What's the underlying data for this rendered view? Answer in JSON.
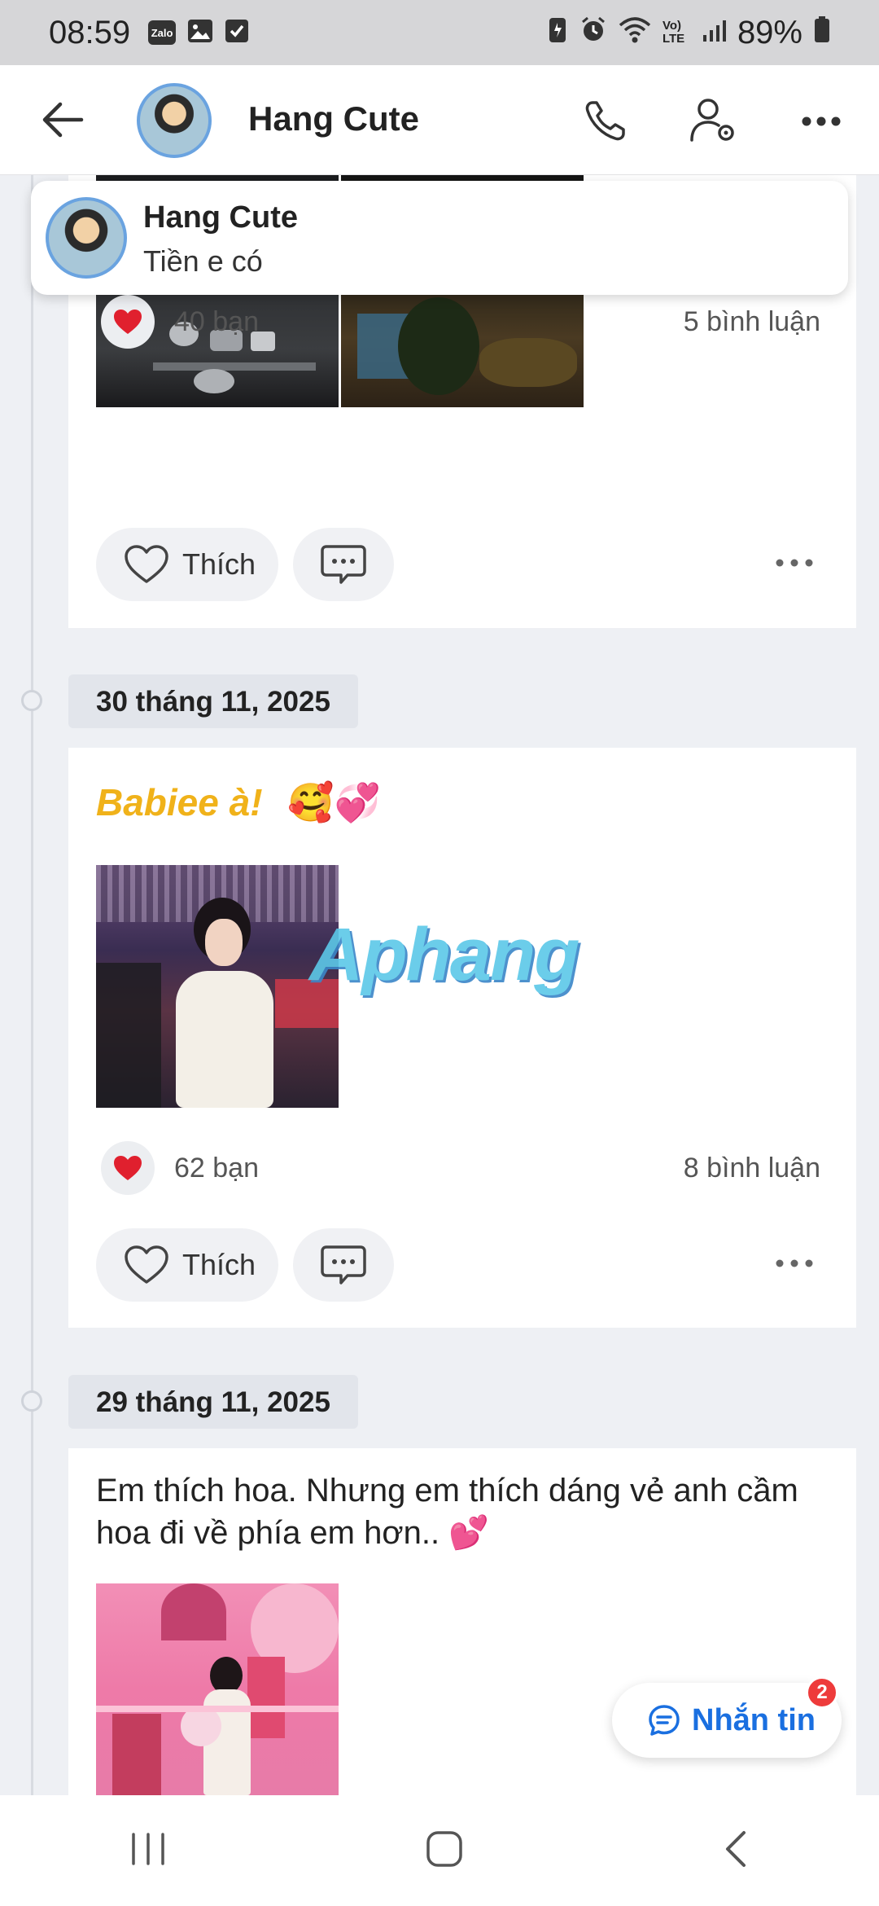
{
  "status_bar": {
    "time": "08:59",
    "left_icons": [
      "zalo-notification-icon",
      "image-icon",
      "checkbox-icon"
    ],
    "zalo_label": "Zalo",
    "network_label": "Vo) LTE",
    "battery": "89%"
  },
  "header": {
    "title": "Hang Cute",
    "icons": [
      "back-arrow-icon",
      "phone-icon",
      "user-settings-icon",
      "more-icon"
    ]
  },
  "toast": {
    "name": "Hang Cute",
    "message": "Tiền e có"
  },
  "posts": [
    {
      "reactions": "40 bạn",
      "comments": "5 bình luận",
      "like_label": "Thích"
    },
    {
      "date": "30 tháng 11, 2025",
      "title": "Babiee à!",
      "title_emoji": "🥰💞",
      "watermark": "Aphang",
      "reactions": "62 bạn",
      "comments": "8 bình luận",
      "like_label": "Thích"
    },
    {
      "date": "29 tháng 11, 2025",
      "text": "Em thích hoa. Nhưng em thích dáng vẻ anh cầm hoa đi về phía em hơn..",
      "text_emoji": "💕"
    }
  ],
  "chat_fab": {
    "label": "Nhắn tin",
    "badge": "2"
  },
  "colors": {
    "accent_blue": "#1a6fe0",
    "title_yellow": "#f0b21a",
    "badge_red": "#ee3b3b",
    "heart_red": "#e0202e"
  }
}
